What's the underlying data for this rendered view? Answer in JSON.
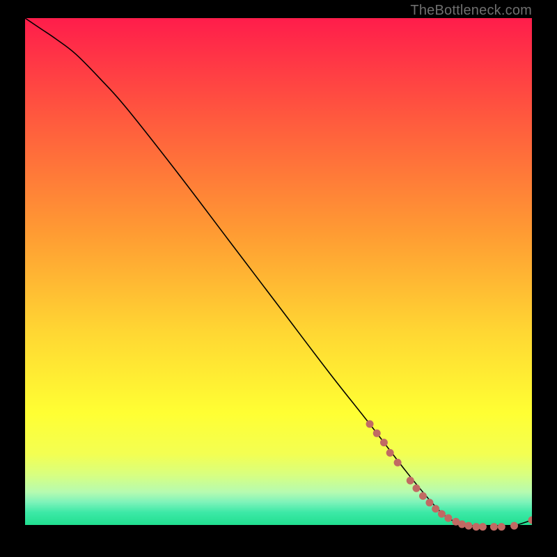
{
  "watermark": "TheBottleneck.com",
  "chart_data": {
    "type": "line",
    "title": "",
    "xlabel": "",
    "ylabel": "",
    "xlim": [
      0,
      100
    ],
    "ylim": [
      0,
      100
    ],
    "grid": false,
    "series": [
      {
        "name": "curve",
        "color": "#000000",
        "x": [
          0,
          3,
          6,
          10,
          15,
          20,
          30,
          40,
          50,
          60,
          68,
          75,
          80,
          83,
          85,
          88,
          90,
          93,
          96,
          100
        ],
        "y": [
          100,
          98,
          96,
          93,
          88,
          82.5,
          70,
          57,
          44,
          31,
          21,
          12,
          6,
          3,
          2,
          1.2,
          1,
          1,
          1.1,
          2.3
        ]
      },
      {
        "name": "dotted-tail",
        "color": "#c16a63",
        "marker": "dot",
        "points": [
          {
            "x": 68.0,
            "y": 21.0
          },
          {
            "x": 69.4,
            "y": 19.2
          },
          {
            "x": 70.8,
            "y": 17.4
          },
          {
            "x": 72.0,
            "y": 15.4
          },
          {
            "x": 73.5,
            "y": 13.5
          },
          {
            "x": 76.0,
            "y": 10.0
          },
          {
            "x": 77.2,
            "y": 8.5
          },
          {
            "x": 78.5,
            "y": 7.0
          },
          {
            "x": 79.8,
            "y": 5.7
          },
          {
            "x": 81.0,
            "y": 4.5
          },
          {
            "x": 82.2,
            "y": 3.5
          },
          {
            "x": 83.5,
            "y": 2.7
          },
          {
            "x": 85.0,
            "y": 2.0
          },
          {
            "x": 86.2,
            "y": 1.5
          },
          {
            "x": 87.5,
            "y": 1.2
          },
          {
            "x": 89.0,
            "y": 1.0
          },
          {
            "x": 90.3,
            "y": 1.0
          },
          {
            "x": 92.5,
            "y": 1.0
          },
          {
            "x": 94.0,
            "y": 1.0
          },
          {
            "x": 96.5,
            "y": 1.2
          },
          {
            "x": 100.0,
            "y": 2.3
          }
        ]
      }
    ],
    "background_gradient": [
      {
        "pos": 0.0,
        "color": "#ff1d4b"
      },
      {
        "pos": 0.2,
        "color": "#ff5a3e"
      },
      {
        "pos": 0.42,
        "color": "#ff9a33"
      },
      {
        "pos": 0.62,
        "color": "#ffd733"
      },
      {
        "pos": 0.78,
        "color": "#ffff33"
      },
      {
        "pos": 0.86,
        "color": "#f3ff52"
      },
      {
        "pos": 0.9,
        "color": "#d9ff7f"
      },
      {
        "pos": 0.935,
        "color": "#b6fbb0"
      },
      {
        "pos": 0.955,
        "color": "#7ef3ba"
      },
      {
        "pos": 0.975,
        "color": "#3de9a7"
      },
      {
        "pos": 1.0,
        "color": "#21df90"
      }
    ]
  }
}
